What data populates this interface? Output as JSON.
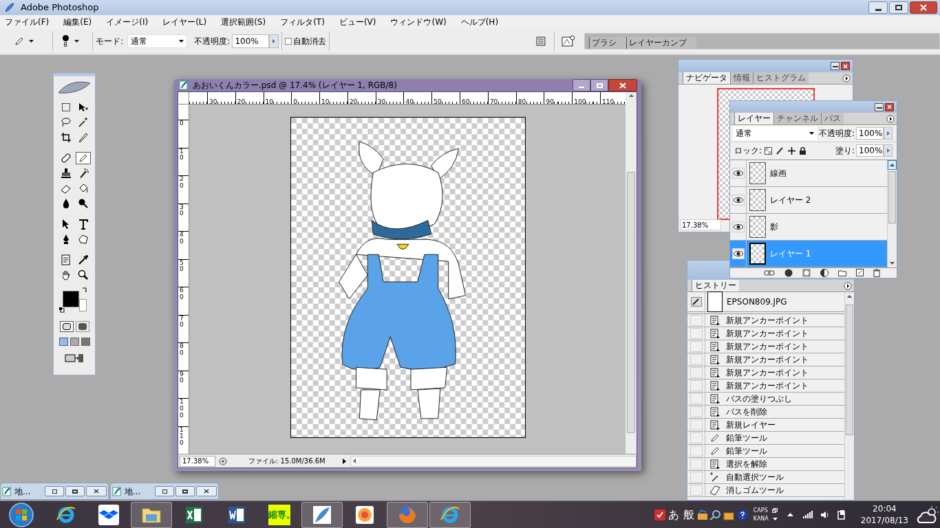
{
  "app_window": {
    "title": "Adobe Photoshop"
  },
  "menu": [
    "ファイル(F)",
    "編集(E)",
    "イメージ(I)",
    "レイヤー(L)",
    "選択範囲(S)",
    "フィルタ(T)",
    "ビュー(V)",
    "ウィンドウ(W)",
    "ヘルプ(H)"
  ],
  "options_bar": {
    "brush_size": "8",
    "mode_label": "モード:",
    "mode_value": "通常",
    "opacity_label": "不透明度:",
    "opacity_value": "100%",
    "auto_erase": {
      "label": "自動消去",
      "checked": false
    },
    "palette_well_tabs": [
      "ブラシ",
      "レイヤーカンプ"
    ]
  },
  "toolbox": {
    "tools": [
      {
        "selected": false
      },
      {
        "selected": false
      },
      {
        "selected": false
      },
      {
        "selected": false
      },
      {
        "selected": false
      },
      {
        "selected": false
      },
      {
        "selected": false
      },
      {
        "selected": true
      },
      {
        "selected": false
      },
      {
        "selected": false
      },
      {
        "selected": false
      },
      {
        "selected": false
      },
      {
        "selected": false
      },
      {
        "selected": false
      },
      {
        "selected": false
      },
      {
        "selected": false
      },
      {
        "selected": false
      },
      {
        "selected": false
      },
      {
        "selected": false
      },
      {
        "selected": false
      },
      {
        "selected": false
      },
      {
        "selected": false
      }
    ]
  },
  "document": {
    "title": "あおいくんカラー.psd @ 17.4% (レイヤー 1, RGB/8)",
    "ruler_h": [
      "30",
      "20",
      "10",
      "0",
      "10",
      "20",
      "30",
      "40",
      "50",
      "60",
      "70",
      "80",
      "90",
      "100",
      "110"
    ],
    "ruler_v": [
      "0",
      "10",
      "20",
      "30",
      "40",
      "50",
      "60",
      "70",
      "80",
      "90",
      "100",
      "110"
    ],
    "zoom": "17.38%",
    "file_info": "ファイル: 15.0M/36.6M"
  },
  "navigator": {
    "tabs": [
      {
        "label": "ナビゲータ",
        "selected": true
      },
      {
        "label": "情報",
        "selected": false
      },
      {
        "label": "ヒストグラム",
        "selected": false
      }
    ],
    "zoom": "17.38%"
  },
  "layers_panel": {
    "tabs": [
      {
        "label": "レイヤー",
        "selected": true
      },
      {
        "label": "チャンネル",
        "selected": false
      },
      {
        "label": "パス",
        "selected": false
      }
    ],
    "blend_mode": "通常",
    "opacity_label": "不透明度:",
    "opacity": "100%",
    "lock_label": "ロック:",
    "fill_label": "塗り:",
    "fill": "100%",
    "layers": [
      {
        "name": "線画",
        "visible": true,
        "selected": false
      },
      {
        "name": "レイヤー 2",
        "visible": true,
        "selected": false
      },
      {
        "name": "影",
        "visible": true,
        "selected": false
      },
      {
        "name": "レイヤー 1",
        "visible": true,
        "selected": true
      }
    ]
  },
  "history": {
    "tabs": [
      {
        "label": "ヒストリー",
        "selected": true
      }
    ],
    "snapshot": "EPSON809.JPG",
    "steps": [
      {
        "label": "新規アンカーポイント",
        "kind": "document"
      },
      {
        "label": "新規アンカーポイント",
        "kind": "document"
      },
      {
        "label": "新規アンカーポイント",
        "kind": "document"
      },
      {
        "label": "新規アンカーポイント",
        "kind": "document"
      },
      {
        "label": "新規アンカーポイント",
        "kind": "document"
      },
      {
        "label": "新規アンカーポイント",
        "kind": "document"
      },
      {
        "label": "パスの塗りつぶし",
        "kind": "document"
      },
      {
        "label": "パスを削除",
        "kind": "document"
      },
      {
        "label": "新規レイヤー",
        "kind": "document"
      },
      {
        "label": "鉛筆ツール",
        "kind": "pencil"
      },
      {
        "label": "鉛筆ツール",
        "kind": "pencil"
      },
      {
        "label": "選択を解除",
        "kind": "document"
      },
      {
        "label": "自動選択ツール",
        "kind": "wand"
      },
      {
        "label": "消しゴムツール",
        "kind": "eraser"
      }
    ]
  },
  "minimized_windows": [
    {
      "title": "地..."
    },
    {
      "title": "地..."
    }
  ],
  "taskbar": {
    "apps": [
      {
        "kind": "ie",
        "running": false
      },
      {
        "kind": "dropbox",
        "running": false
      },
      {
        "kind": "explorer",
        "running": true
      },
      {
        "kind": "excel",
        "running": false
      },
      {
        "kind": "word",
        "running": false
      },
      {
        "kind": "text",
        "label": "縮専。",
        "running": false
      },
      {
        "kind": "photoshop",
        "running": true
      },
      {
        "kind": "flower",
        "running": false
      },
      {
        "kind": "firefox",
        "running": true
      },
      {
        "kind": "ie",
        "running": true
      }
    ],
    "tray": {
      "ime_mode": "あ",
      "ime_dict": "般",
      "caps": "CAPS",
      "kana": "KANA",
      "time": "20:04",
      "date": "2017/08/13"
    }
  }
}
